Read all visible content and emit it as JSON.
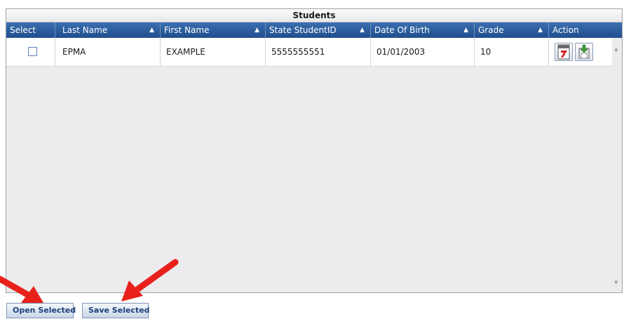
{
  "grid": {
    "title": "Students",
    "columns": [
      "Select",
      "Last Name",
      "First Name",
      "State StudentID",
      "Date Of Birth",
      "Grade",
      "Action"
    ],
    "sort_indicator": "▲",
    "rows": [
      {
        "selected": false,
        "last_name": "EPMA",
        "first_name": "EXAMPLE",
        "state_student_id": "5555555551",
        "date_of_birth": "01/01/2003",
        "grade": "10",
        "actions": [
          "pdf-icon",
          "save-download-icon"
        ]
      }
    ]
  },
  "buttons": {
    "open_selected": "Open Selected",
    "save_selected": "Save Selected"
  },
  "colors": {
    "header_bg": "#1f4e8c",
    "arrow": "#e8211b",
    "button_text": "#1c3f7a"
  }
}
